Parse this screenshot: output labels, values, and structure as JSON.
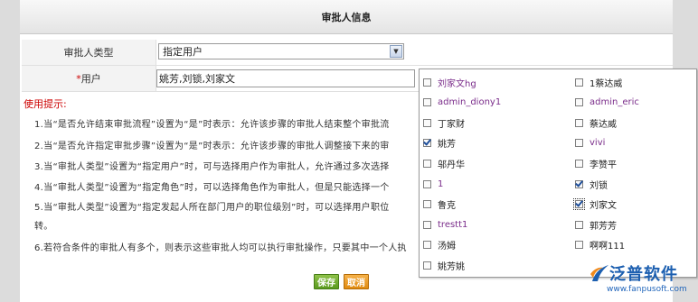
{
  "header": {
    "title": "审批人信息"
  },
  "form": {
    "approver_type": {
      "label": "审批人类型",
      "value": "指定用户"
    },
    "user": {
      "required_mark": "*",
      "label": "用户",
      "value": "姚芳,刘锁,刘家文"
    }
  },
  "tips": {
    "title": "使用提示:",
    "lines": [
      "1.当“是否允许结束审批流程”设置为“是”时表示：允许该步骤的审批人结束整个审批流",
      "2.当“是否允许指定审批步骤”设置为“是”时表示：允许该步骤的审批人调整接下来的审",
      "3.当“审批人类型”设置为“指定用户”时，可与选择用户作为审批人，允许通过多次选择",
      "4.当“审批人类型”设置为“指定角色”时，可以选择角色作为审批人，但是只能选择一个",
      "5.当“审批人类型”设置为“指定发起人所在部门用户的职位级别”时，可以选择用户职位",
      "转。",
      "6.若符合条件的审批人有多个，则表示这些审批人均可以执行审批操作，只要其中一个人执"
    ]
  },
  "buttons": {
    "save": "保存",
    "cancel": "取消"
  },
  "user_options": {
    "left": [
      {
        "label": "刘家文hg",
        "checked": false,
        "link": true
      },
      {
        "label": "admin_diony1",
        "checked": false,
        "link": true
      },
      {
        "label": "丁家财",
        "checked": false,
        "link": false
      },
      {
        "label": "姚芳",
        "checked": true,
        "link": false
      },
      {
        "label": "邬丹华",
        "checked": false,
        "link": false
      },
      {
        "label": "1",
        "checked": false,
        "link": true
      },
      {
        "label": "鲁克",
        "checked": false,
        "link": false
      },
      {
        "label": "trestt1",
        "checked": false,
        "link": true
      },
      {
        "label": "汤姆",
        "checked": false,
        "link": false
      },
      {
        "label": "姚芳姚",
        "checked": false,
        "link": false
      }
    ],
    "right": [
      {
        "label": "1蔡达威",
        "checked": false,
        "link": false
      },
      {
        "label": "admin_eric",
        "checked": false,
        "link": true
      },
      {
        "label": "蔡达威",
        "checked": false,
        "link": false
      },
      {
        "label": "vivi",
        "checked": false,
        "link": true
      },
      {
        "label": "李赞平",
        "checked": false,
        "link": false
      },
      {
        "label": "刘锁",
        "checked": true,
        "link": false
      },
      {
        "label": "刘家文",
        "checked": true,
        "link": false,
        "focused": true
      },
      {
        "label": "郭芳芳",
        "checked": false,
        "link": false
      },
      {
        "label": "啊啊111",
        "checked": false,
        "link": false
      }
    ]
  },
  "logo": {
    "name": "泛普软件",
    "url": "www.fanpusoft.com"
  },
  "colors": {
    "brand_blue": "#1c5fb0",
    "link_purple": "#7a2c8a",
    "required_red": "#cc0000",
    "save_green": "#5a9a1e",
    "cancel_orange": "#e08a10"
  }
}
